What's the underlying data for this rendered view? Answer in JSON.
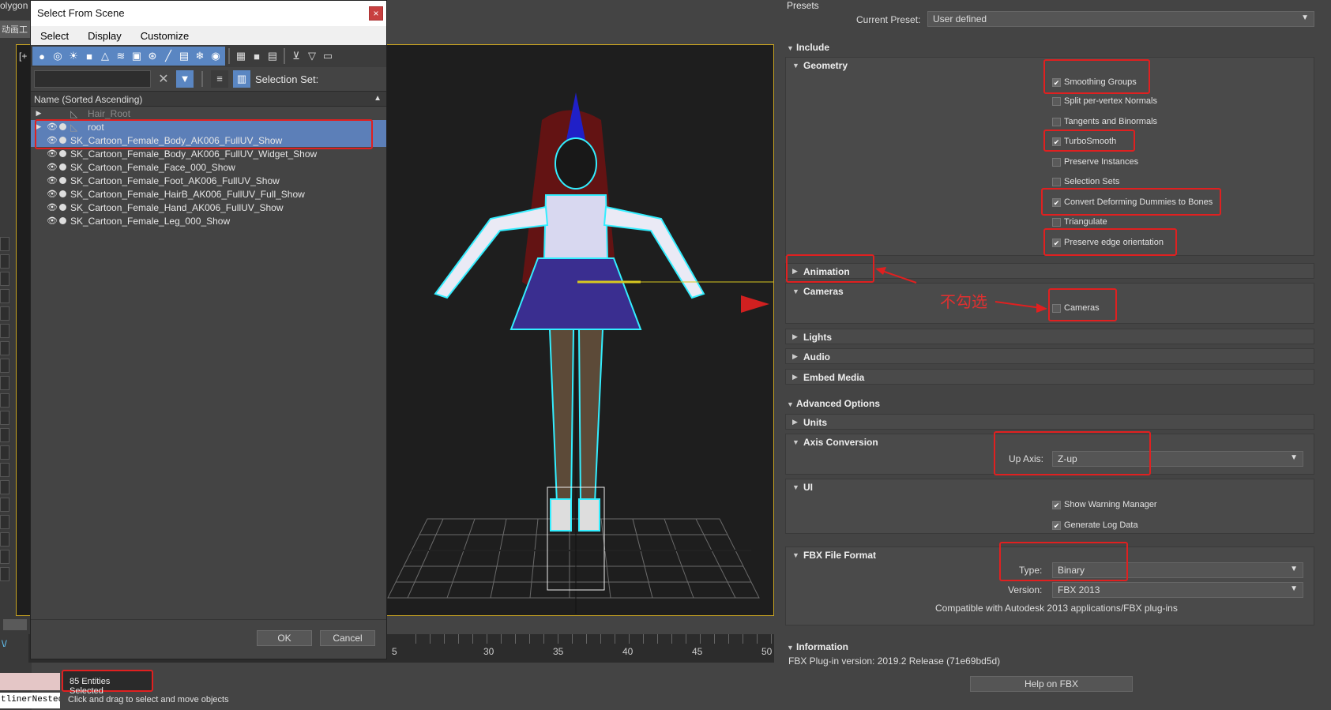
{
  "app": {
    "title_fragment": "olygon",
    "cn_tab": "动画工",
    "viewport_label": "[+",
    "outliner_label": "tlinerNested",
    "status_hint": "Click and drag to select and move objects",
    "entities_selected": "85 Entities Selected"
  },
  "timeline": {
    "labels": [
      "5",
      "30",
      "35",
      "40",
      "45",
      "50"
    ]
  },
  "dialog": {
    "title": "Select From Scene",
    "close_label": "×",
    "menu": [
      "Select",
      "Display",
      "Customize"
    ],
    "filter_placeholder": "",
    "clear_label": "✕",
    "selection_set_label": "Selection Set:",
    "column_header": "Name (Sorted Ascending)",
    "tree_rows": [
      {
        "label": "Hair_Root",
        "hidden": true,
        "expand": true,
        "bone": true
      },
      {
        "label": "root",
        "selected": true,
        "expand": true,
        "bone": true
      },
      {
        "label": "SK_Cartoon_Female_Body_AK006_FullUV_Show",
        "selected": true
      },
      {
        "label": "SK_Cartoon_Female_Body_AK006_FullUV_Widget_Show"
      },
      {
        "label": "SK_Cartoon_Female_Face_000_Show"
      },
      {
        "label": "SK_Cartoon_Female_Foot_AK006_FullUV_Show"
      },
      {
        "label": "SK_Cartoon_Female_HairB_AK006_FullUV_Full_Show"
      },
      {
        "label": "SK_Cartoon_Female_Hand_AK006_FullUV_Show"
      },
      {
        "label": "SK_Cartoon_Female_Leg_000_Show"
      }
    ],
    "ok_label": "OK",
    "cancel_label": "Cancel"
  },
  "fbx": {
    "presets_label": "Presets",
    "current_preset_label": "Current Preset:",
    "current_preset_value": "User defined",
    "include_label": "Include",
    "geometry_label": "Geometry",
    "geometry_options": [
      {
        "label": "Smoothing Groups",
        "checked": true
      },
      {
        "label": "Split per-vertex Normals",
        "checked": false
      },
      {
        "label": "Tangents and Binormals",
        "checked": false
      },
      {
        "label": "TurboSmooth",
        "checked": true
      },
      {
        "label": "Preserve Instances",
        "checked": false
      },
      {
        "label": "Selection Sets",
        "checked": false
      },
      {
        "label": "Convert Deforming Dummies to Bones",
        "checked": true
      },
      {
        "label": "Triangulate",
        "checked": false
      },
      {
        "label": "Preserve edge orientation",
        "checked": true
      }
    ],
    "animation_label": "Animation",
    "cameras_label": "Cameras",
    "cameras_option": {
      "label": "Cameras",
      "checked": false
    },
    "cameras_note": "不勾选",
    "lights_label": "Lights",
    "audio_label": "Audio",
    "embed_media_label": "Embed Media",
    "advanced_label": "Advanced Options",
    "units_label": "Units",
    "axis_conversion_label": "Axis Conversion",
    "up_axis_label": "Up Axis:",
    "up_axis_value": "Z-up",
    "ui_label": "UI",
    "ui_options": [
      {
        "label": "Show Warning Manager",
        "checked": true
      },
      {
        "label": "Generate Log Data",
        "checked": true
      }
    ],
    "fbx_format_label": "FBX File Format",
    "type_label": "Type:",
    "type_value": "Binary",
    "version_label": "Version:",
    "version_value": "FBX 2013",
    "compat_text": "Compatible with Autodesk 2013 applications/FBX plug-ins",
    "information_label": "Information",
    "plugin_version_text": "FBX Plug-in version: 2019.2 Release (71e69bd5d)",
    "help_label": "Help on FBX"
  },
  "colors": {
    "highlight": "#e02020",
    "selection_blue": "#5c7fb8",
    "viewport_border": "#c8a422"
  }
}
